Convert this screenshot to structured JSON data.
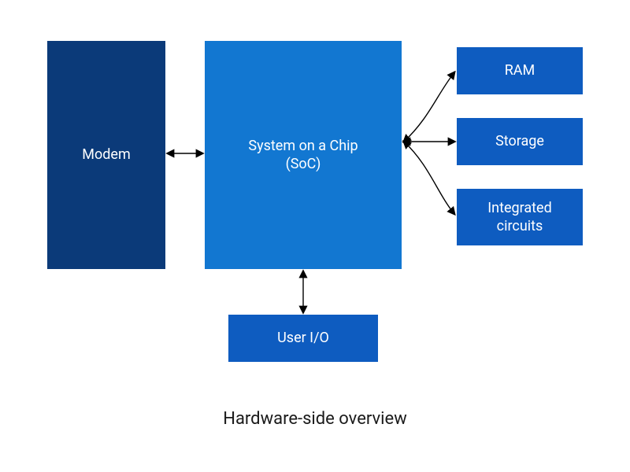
{
  "diagram": {
    "caption": "Hardware-side overview",
    "blocks": {
      "modem": {
        "label": "Modem",
        "color": "#0b3a79"
      },
      "soc": {
        "label": "System on a Chip\n(SoC)",
        "color": "#1277d1"
      },
      "ram": {
        "label": "RAM",
        "color": "#0e5cc0"
      },
      "storage": {
        "label": "Storage",
        "color": "#0e5cc0"
      },
      "ic": {
        "label": "Integrated\ncircuits",
        "color": "#0e5cc0"
      },
      "userio": {
        "label": "User I/O",
        "color": "#0e5cc0"
      }
    }
  }
}
